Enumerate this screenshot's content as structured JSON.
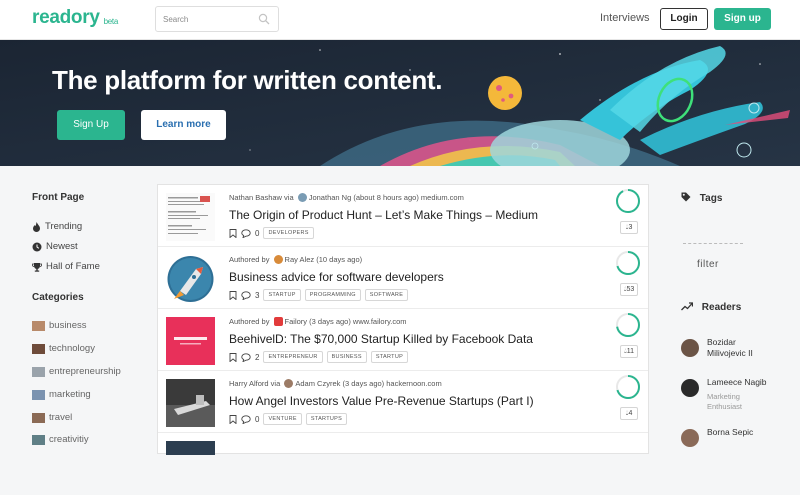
{
  "header": {
    "logo": "readory",
    "beta": "beta",
    "search_placeholder": "Search",
    "interviews": "Interviews",
    "login": "Login",
    "signup": "Sign up"
  },
  "hero": {
    "title": "The platform for written content.",
    "signup": "Sign Up",
    "learn_more": "Learn more"
  },
  "sidebar": {
    "front_page": "Front Page",
    "items": [
      {
        "label": "Trending",
        "icon": "flame-icon"
      },
      {
        "label": "Newest",
        "icon": "clock-icon"
      },
      {
        "label": "Hall of Fame",
        "icon": "trophy-icon"
      }
    ],
    "categories_title": "Categories",
    "categories": [
      {
        "label": "business",
        "color": "#b88a6a"
      },
      {
        "label": "technology",
        "color": "#6e4b3a"
      },
      {
        "label": "entrepreneurship",
        "color": "#9aa3ab"
      },
      {
        "label": "marketing",
        "color": "#7b93b0"
      },
      {
        "label": "travel",
        "color": "#8b6a55"
      },
      {
        "label": "creativitiy",
        "color": "#5f7f86"
      }
    ]
  },
  "feed": [
    {
      "meta_pre": "Nathan Bashaw via",
      "meta_author": "Jonathan Ng",
      "meta_post": "(about 8 hours ago) medium.com",
      "title": "The Origin of Product Hunt – Let’s Make Things – Medium",
      "comments": "0",
      "tags": [
        "DEVELOPERS"
      ],
      "score": "3",
      "ring": 0.92
    },
    {
      "meta_pre": "Authored by",
      "meta_author": "Ray Alez",
      "meta_post": "(10 days ago)",
      "title": "Business advice for software developers",
      "comments": "3",
      "tags": [
        "STARTUP",
        "PROGRAMMING",
        "SOFTWARE"
      ],
      "score": "53",
      "ring": 0.7
    },
    {
      "meta_pre": "Authored by",
      "meta_author": "Failory",
      "meta_post": "(3 days ago) www.failory.com",
      "title": "BeehivelD: The $70,000 Startup Killed by Facebook Data",
      "comments": "2",
      "tags": [
        "ENTREPRENEUR",
        "BUSINESS",
        "STARTUP"
      ],
      "score": "11",
      "ring": 0.72
    },
    {
      "meta_pre": "Harry Alford via",
      "meta_author": "Adam Czyrek",
      "meta_post": "(3 days ago) hackernoon.com",
      "title": "How Angel Investors Value Pre-Revenue Startups (Part I)",
      "comments": "0",
      "tags": [
        "VENTURE",
        "STARTUPS"
      ],
      "score": "4",
      "ring": 0.7
    }
  ],
  "right": {
    "tags_title": "Tags",
    "filter": "filter",
    "readers_title": "Readers",
    "readers": [
      {
        "name1": "Bozidar",
        "name2": "Milivojevic II",
        "sub": ""
      },
      {
        "name1": "Lameece Nagib",
        "name2": "",
        "sub1": "Marketing",
        "sub2": "Enthusiast"
      },
      {
        "name1": "Borna Sepic",
        "name2": "",
        "sub": ""
      }
    ]
  },
  "colors": {
    "accent": "#2bb58f",
    "hero_bg": "#1e2a38"
  }
}
